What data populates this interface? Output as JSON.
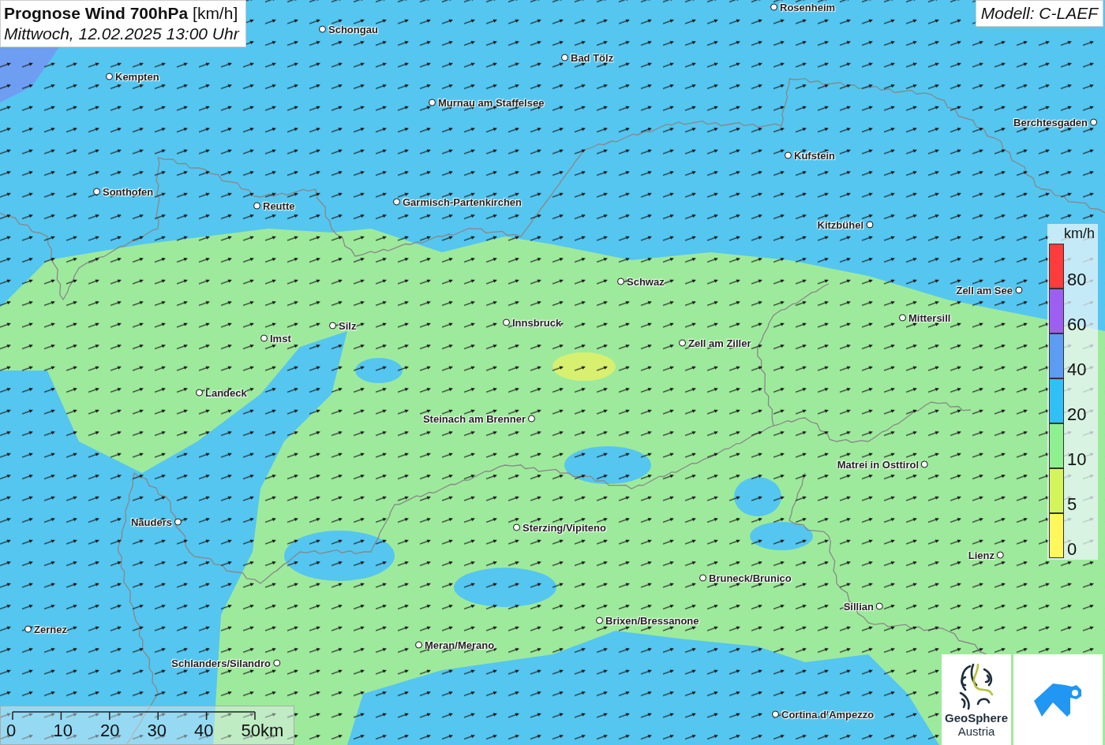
{
  "title": {
    "heading": "Prognose Wind 700hPa",
    "unit": "[km/h]",
    "subtitle": "Mittwoch, 12.02.2025 13:00 Uhr"
  },
  "model": "Modell: C-LAEF",
  "cities": [
    {
      "name": "Schongau"
    },
    {
      "name": "Rosenheim"
    },
    {
      "name": "Bad Tölz"
    },
    {
      "name": "Kempten"
    },
    {
      "name": "Murnau am Staffelsee"
    },
    {
      "name": "Berchtesgaden"
    },
    {
      "name": "Kufstein"
    },
    {
      "name": "Sonthofen"
    },
    {
      "name": "Reutte"
    },
    {
      "name": "Garmisch-Partenkirchen"
    },
    {
      "name": "Kitzbühel"
    },
    {
      "name": "Schwaz"
    },
    {
      "name": "Zell am See"
    },
    {
      "name": "Mittersill"
    },
    {
      "name": "Silz"
    },
    {
      "name": "Innsbruck"
    },
    {
      "name": "Imst"
    },
    {
      "name": "Zell am Ziller"
    },
    {
      "name": "Landeck"
    },
    {
      "name": "Steinach am Brenner"
    },
    {
      "name": "Matrei in Osttirol"
    },
    {
      "name": "Nauders"
    },
    {
      "name": "Sterzing/Vipiteno"
    },
    {
      "name": "Lienz"
    },
    {
      "name": "Bruneck/Brunico"
    },
    {
      "name": "Sillian"
    },
    {
      "name": "Brixen/Bressanone"
    },
    {
      "name": "Zernez"
    },
    {
      "name": "Meran/Merano"
    },
    {
      "name": "Schlanders/Silandro"
    },
    {
      "name": "Cortina d'Ampezzo"
    }
  ],
  "legend": {
    "unit": "km/h",
    "classes": [
      {
        "label": "80",
        "color": "#ff3b3b"
      },
      {
        "label": "60",
        "color": "#9d5ff2"
      },
      {
        "label": "40",
        "color": "#5c9cf2"
      },
      {
        "label": "20",
        "color": "#2fc1f6"
      },
      {
        "label": "10",
        "color": "#8ff08f"
      },
      {
        "label": "5",
        "color": "#d3f55b"
      },
      {
        "label": "0",
        "color": "#fff75c"
      }
    ]
  },
  "scale_bar": {
    "labels": [
      "0",
      "10",
      "20",
      "30",
      "40",
      "50km"
    ]
  },
  "logo": {
    "name": "GeoSphere",
    "subname": "Austria"
  }
}
